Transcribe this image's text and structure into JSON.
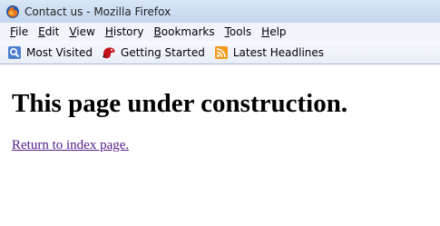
{
  "window": {
    "title": "Contact us - Mozilla Firefox",
    "icon": "firefox-icon"
  },
  "menubar": {
    "items": [
      {
        "accel": "F",
        "rest": "ile"
      },
      {
        "accel": "E",
        "rest": "dit"
      },
      {
        "accel": "V",
        "rest": "iew"
      },
      {
        "accel": "H",
        "rest": "istory"
      },
      {
        "accel": "B",
        "rest": "ookmarks"
      },
      {
        "accel": "T",
        "rest": "ools"
      },
      {
        "accel": "H",
        "rest": "elp"
      }
    ]
  },
  "bookmarks": {
    "items": [
      {
        "label": "Most Visited",
        "icon": "most-visited-icon"
      },
      {
        "label": "Getting Started",
        "icon": "getting-started-icon"
      },
      {
        "label": "Latest Headlines",
        "icon": "rss-feed-icon"
      }
    ]
  },
  "page": {
    "heading": "This page under construction.",
    "link_text": "Return to index page.",
    "link_color": "#551a8b"
  }
}
